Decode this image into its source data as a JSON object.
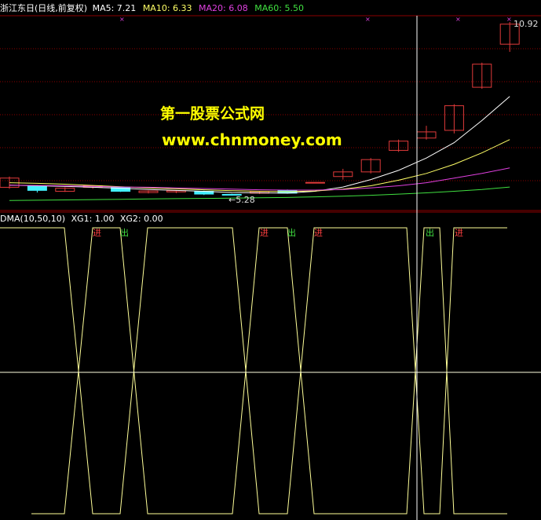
{
  "colors": {
    "background": "#000000",
    "grid": "#8b0000",
    "up": "#e03a3a",
    "down": "#44f0ff",
    "ma5": "#ffffff",
    "ma10": "#ffff66",
    "ma20": "#e040e0",
    "ma60": "#40e040",
    "signal": "#ffff99",
    "watermark": "#ffff00"
  },
  "header": {
    "stock": "浙江东日(日线,前复权)",
    "ma5": "MA5: 7.21",
    "ma10": "MA10: 6.33",
    "ma20": "MA20: 6.08",
    "ma60": "MA60: 5.50"
  },
  "sub_header": {
    "indicator": "DMA(10,50,10)",
    "xg1": "XG1: 1.00",
    "xg2": "XG2: 0.00"
  },
  "watermark": {
    "title": "第一股票公式网",
    "url": "www.chnmoney.com"
  },
  "annotations": {
    "high_price": "10.92",
    "low_price": "5.28"
  },
  "signals": [
    {
      "label": "进",
      "kind": "buy"
    },
    {
      "label": "出",
      "kind": "sell"
    },
    {
      "label": "进",
      "kind": "buy"
    },
    {
      "label": "出",
      "kind": "sell"
    },
    {
      "label": "进",
      "kind": "buy"
    },
    {
      "label": "出",
      "kind": "sell"
    },
    {
      "label": "进",
      "kind": "buy"
    }
  ],
  "chart_data": {
    "type": "line",
    "candles": [
      {
        "open": 5.55,
        "close": 5.85,
        "high": 5.9,
        "low": 5.5
      },
      {
        "open": 5.6,
        "close": 5.45,
        "high": 5.62,
        "low": 5.38
      },
      {
        "open": 5.42,
        "close": 5.52,
        "high": 5.55,
        "low": 5.4
      },
      {
        "open": 5.55,
        "close": 5.6,
        "high": 5.62,
        "low": 5.5
      },
      {
        "open": 5.55,
        "close": 5.42,
        "high": 5.57,
        "low": 5.4
      },
      {
        "open": 5.38,
        "close": 5.43,
        "high": 5.45,
        "low": 5.35
      },
      {
        "open": 5.4,
        "close": 5.44,
        "high": 5.46,
        "low": 5.36
      },
      {
        "open": 5.42,
        "close": 5.33,
        "high": 5.44,
        "low": 5.3
      },
      {
        "open": 5.32,
        "close": 5.31,
        "high": 5.34,
        "low": 5.28
      },
      {
        "open": 5.36,
        "close": 5.41,
        "high": 5.43,
        "low": 5.33
      },
      {
        "open": 5.45,
        "close": 5.36,
        "high": 5.48,
        "low": 5.34
      },
      {
        "open": 5.71,
        "close": 5.71,
        "high": 5.71,
        "low": 5.71
      },
      {
        "open": 5.9,
        "close": 6.05,
        "high": 6.15,
        "low": 5.8
      },
      {
        "open": 6.05,
        "close": 6.45,
        "high": 6.5,
        "low": 6.0
      },
      {
        "open": 6.75,
        "close": 7.05,
        "high": 7.1,
        "low": 6.7
      },
      {
        "open": 7.15,
        "close": 7.35,
        "high": 7.55,
        "low": 7.1
      },
      {
        "open": 7.4,
        "close": 8.2,
        "high": 8.25,
        "low": 7.3
      },
      {
        "open": 8.8,
        "close": 9.55,
        "high": 9.6,
        "low": 8.75
      },
      {
        "open": 10.2,
        "close": 10.85,
        "high": 10.92,
        "low": 9.95
      }
    ],
    "ma5": [
      5.62,
      5.6,
      5.58,
      5.55,
      5.52,
      5.48,
      5.45,
      5.42,
      5.38,
      5.37,
      5.36,
      5.42,
      5.56,
      5.8,
      6.1,
      6.5,
      7.0,
      7.72,
      8.5
    ],
    "ma10": [
      5.7,
      5.68,
      5.65,
      5.61,
      5.57,
      5.53,
      5.5,
      5.47,
      5.44,
      5.42,
      5.41,
      5.43,
      5.49,
      5.6,
      5.78,
      6.0,
      6.3,
      6.67,
      7.1
    ],
    "ma20": [
      5.62,
      5.61,
      5.6,
      5.58,
      5.56,
      5.55,
      5.53,
      5.51,
      5.49,
      5.47,
      5.46,
      5.46,
      5.48,
      5.53,
      5.6,
      5.7,
      5.85,
      6.0,
      6.18
    ],
    "ma60": [
      5.12,
      5.13,
      5.14,
      5.15,
      5.16,
      5.17,
      5.18,
      5.19,
      5.2,
      5.21,
      5.22,
      5.24,
      5.26,
      5.29,
      5.33,
      5.37,
      5.42,
      5.48,
      5.56
    ],
    "xg_levels": [
      1,
      0
    ],
    "ylim": [
      5.0,
      11.0
    ]
  }
}
